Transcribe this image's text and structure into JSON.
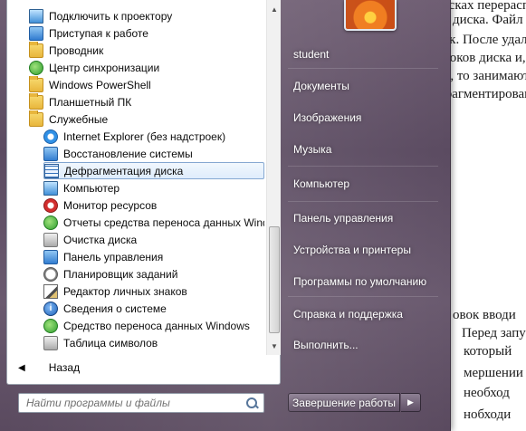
{
  "document": {
    "lines": [
      "дисках перераспр",
      "диска. Файл или",
      "рек. После удал",
      "блоков диска и, е",
      "ки, то занимают",
      "фрагментирован",
      "овок вводи",
      "Перед запуско",
      "который",
      "мершении",
      "необход",
      "нобходи"
    ]
  },
  "start_menu": {
    "programs": [
      {
        "label": "Подключить к проектору",
        "icon": "projector-icon"
      },
      {
        "label": "Приступая к работе",
        "icon": "getting-started-icon"
      },
      {
        "label": "Проводник",
        "icon": "folder-explorer-icon"
      },
      {
        "label": "Центр синхронизации",
        "icon": "sync-center-icon"
      },
      {
        "label": "Windows PowerShell",
        "icon": "folder-icon"
      },
      {
        "label": "Планшетный ПК",
        "icon": "folder-icon"
      },
      {
        "label": "Служебные",
        "icon": "folder-icon"
      },
      {
        "label": "Internet Explorer (без надстроек)",
        "icon": "internet-explorer-icon"
      },
      {
        "label": "Восстановление системы",
        "icon": "system-restore-icon"
      },
      {
        "label": "Дефрагментация диска",
        "icon": "defrag-icon"
      },
      {
        "label": "Компьютер",
        "icon": "computer-icon"
      },
      {
        "label": "Монитор ресурсов",
        "icon": "resource-monitor-icon"
      },
      {
        "label": "Отчеты средства переноса данных Wind",
        "icon": "transfer-reports-icon"
      },
      {
        "label": "Очистка диска",
        "icon": "disk-cleanup-icon"
      },
      {
        "label": "Панель управления",
        "icon": "control-panel-icon"
      },
      {
        "label": "Планировщик заданий",
        "icon": "task-scheduler-icon"
      },
      {
        "label": "Редактор личных знаков",
        "icon": "char-editor-icon"
      },
      {
        "label": "Сведения о системе",
        "icon": "system-info-icon"
      },
      {
        "label": "Средство переноса данных Windows",
        "icon": "easy-transfer-icon"
      },
      {
        "label": "Таблица символов",
        "icon": "char-map-icon"
      }
    ],
    "selected_index": 9,
    "back_label": "Назад",
    "search_placeholder": "Найти программы и файлы",
    "right_items": [
      "student",
      "Документы",
      "Изображения",
      "Музыка",
      "Компьютер",
      "Панель управления",
      "Устройства и принтеры",
      "Программы по умолчанию",
      "Справка и поддержка",
      "Выполнить..."
    ],
    "shutdown_label": "Завершение работы"
  }
}
